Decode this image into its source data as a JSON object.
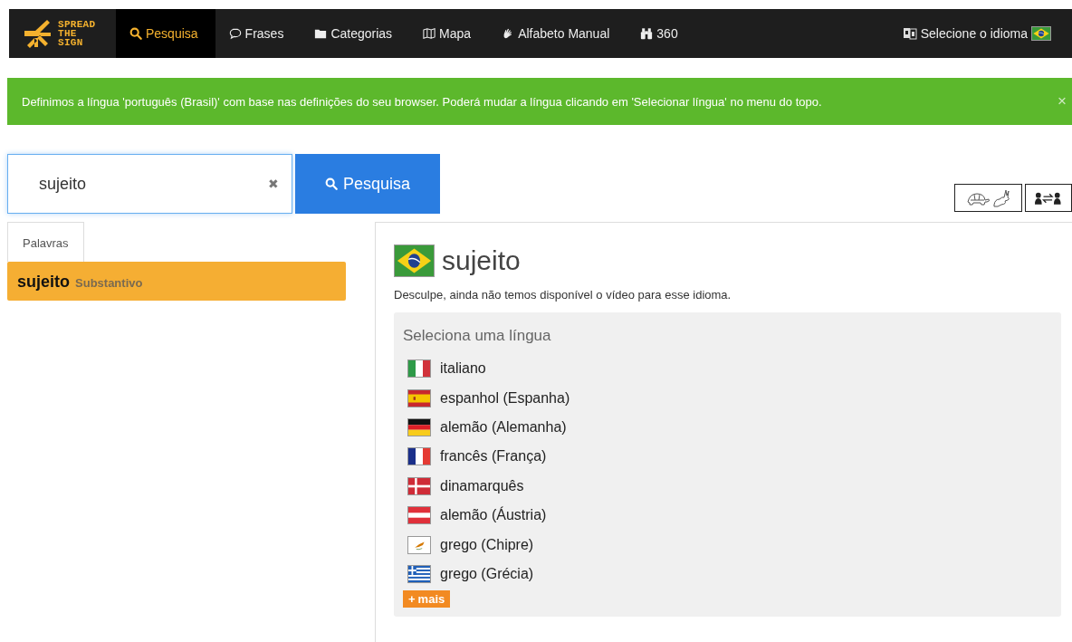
{
  "nav": {
    "logo": [
      "SPREAD",
      "THE",
      "SIGN"
    ],
    "items": [
      {
        "label": "Pesquisa",
        "selected": true
      },
      {
        "label": "Frases",
        "selected": false
      },
      {
        "label": "Categorias",
        "selected": false
      },
      {
        "label": "Mapa",
        "selected": false
      },
      {
        "label": "Alfabeto Manual",
        "selected": false
      },
      {
        "label": "360",
        "selected": false
      }
    ],
    "language": {
      "label": "Selecione o idioma"
    }
  },
  "alert": {
    "message": "Definimos a língua 'português (Brasil)' com base nas definições do seu browser. Poderá mudar a língua clicando em 'Selecionar língua' no menu do topo.",
    "close": "×"
  },
  "search": {
    "value": "sujeito",
    "clear": "✖",
    "button": "Pesquisa"
  },
  "results": {
    "tabs": [
      {
        "label": "Palavras",
        "selected": true
      }
    ],
    "items": [
      {
        "word": "sujeito",
        "type": "Substantivo",
        "selected": true
      }
    ]
  },
  "word": {
    "title": "sujeito",
    "notice": "Desculpe, ainda não temos disponível o vídeo para esse idioma.",
    "languages": {
      "title": "Seleciona uma língua",
      "items": [
        {
          "label": "italiano"
        },
        {
          "label": "espanhol (Espanha)"
        },
        {
          "label": "alemão (Alemanha)"
        },
        {
          "label": "francês (França)"
        },
        {
          "label": "dinamarquês"
        },
        {
          "label": "alemão (Áustria)"
        },
        {
          "label": "grego (Chipre)"
        },
        {
          "label": "grego (Grécia)"
        }
      ],
      "more": {
        "icon": "+",
        "label": "mais"
      }
    }
  }
}
